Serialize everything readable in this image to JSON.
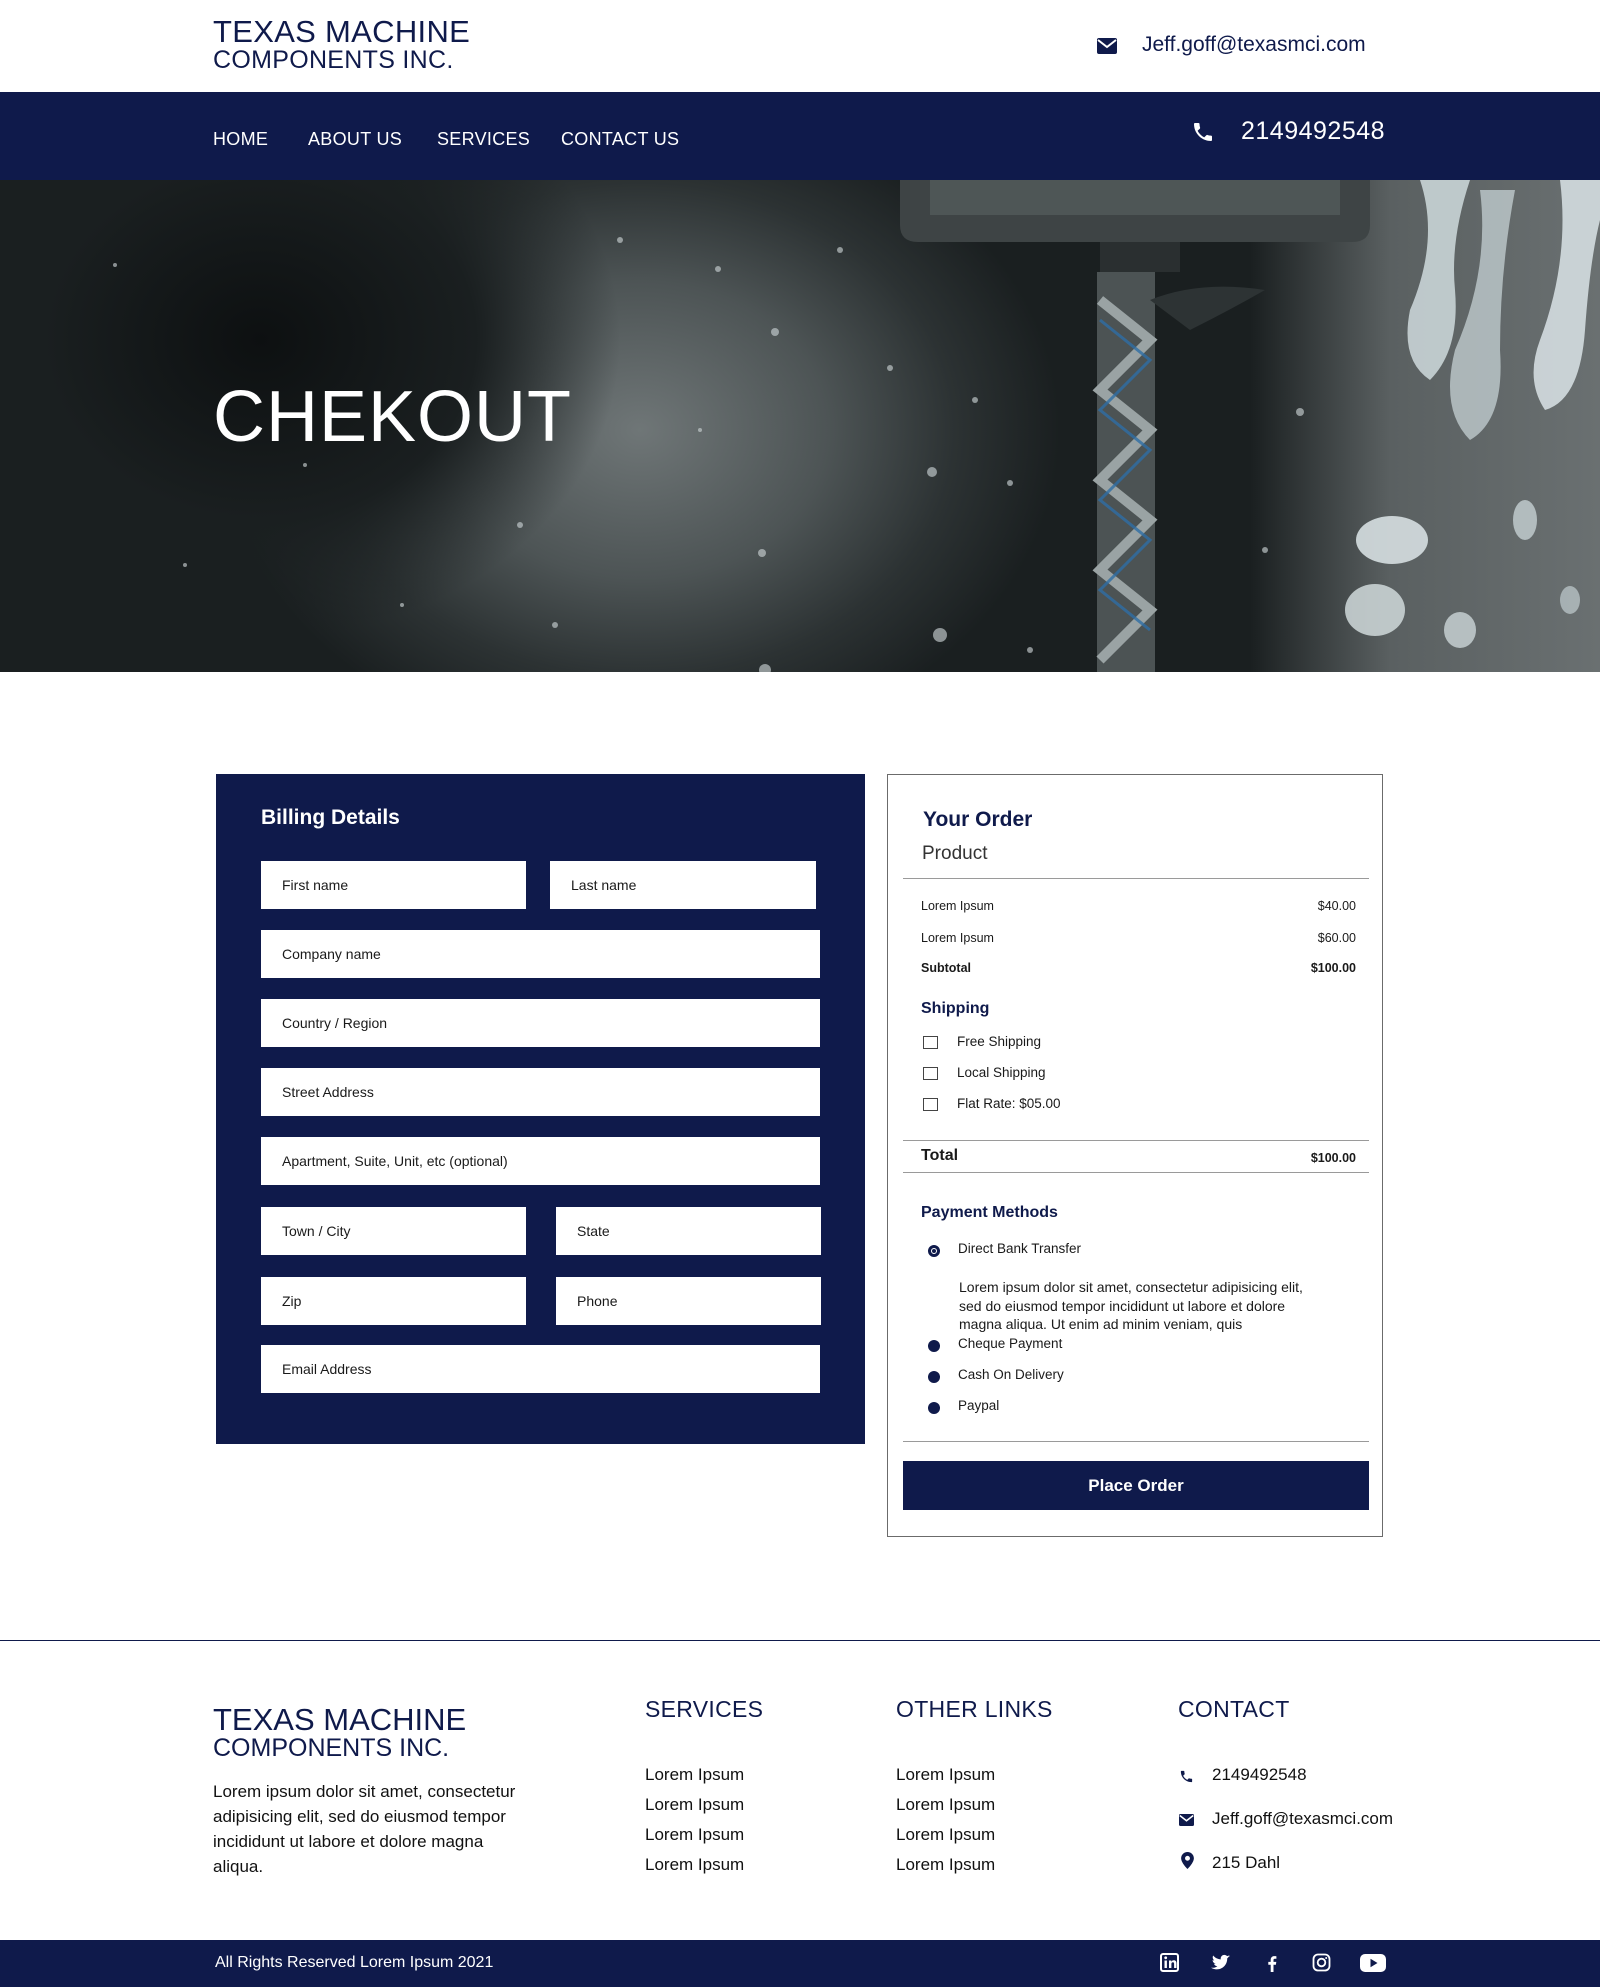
{
  "header": {
    "logo_line1": "TEXAS MACHINE",
    "logo_line2": "COMPONENTS INC.",
    "email": "Jeff.goff@texasmci.com"
  },
  "nav": {
    "items": [
      {
        "label": "HOME"
      },
      {
        "label": "ABOUT US"
      },
      {
        "label": "SERVICES"
      },
      {
        "label": "CONTACT US"
      }
    ],
    "phone": "2149492548"
  },
  "hero": {
    "title": "CHEKOUT"
  },
  "billing": {
    "title": "Billing Details",
    "fields": {
      "first_name": "First name",
      "last_name": "Last name",
      "company": "Company name",
      "country": "Country / Region",
      "street": "Street Address",
      "apartment": "Apartment, Suite, Unit, etc (optional)",
      "town": "Town / City",
      "state": "State",
      "zip": "Zip",
      "phone": "Phone",
      "email": "Email Address"
    }
  },
  "order": {
    "title": "Your Order",
    "product_header": "Product",
    "items": [
      {
        "name": "Lorem Ipsum",
        "price": "$40.00"
      },
      {
        "name": "Lorem Ipsum",
        "price": "$60.00"
      }
    ],
    "subtotal_label": "Subtotal",
    "subtotal_value": "$100.00",
    "shipping_title": "Shipping",
    "shipping_options": [
      {
        "label": "Free Shipping",
        "checked": false
      },
      {
        "label": "Local Shipping",
        "checked": false
      },
      {
        "label": "Flat Rate: $05.00",
        "checked": false
      }
    ],
    "total_label": "Total",
    "total_value": "$100.00",
    "payment_title": "Payment Methods",
    "payment_methods": [
      {
        "label": "Direct Bank Transfer",
        "selected": true
      },
      {
        "label": "Cheque Payment",
        "selected": false
      },
      {
        "label": "Cash On Delivery",
        "selected": false
      },
      {
        "label": "Paypal",
        "selected": false
      }
    ],
    "payment_description": "Lorem ipsum dolor sit amet, consectetur adipisicing elit, sed do eiusmod tempor incididunt ut labore et dolore magna aliqua. Ut enim ad minim veniam, quis",
    "place_order_label": "Place Order"
  },
  "footer": {
    "logo_line1": "TEXAS MACHINE",
    "logo_line2": "COMPONENTS INC.",
    "description": "Lorem ipsum dolor sit amet, consectetur adipisicing elit, sed do eiusmod tempor incididunt ut labore et dolore magna aliqua.",
    "services_title": "SERVICES",
    "services_links": [
      "Lorem Ipsum",
      "Lorem Ipsum",
      "Lorem Ipsum",
      "Lorem Ipsum"
    ],
    "other_title": "OTHER LINKS",
    "other_links": [
      "Lorem Ipsum",
      "Lorem Ipsum",
      "Lorem Ipsum",
      "Lorem Ipsum"
    ],
    "contact_title": "CONTACT",
    "contact_phone": "2149492548",
    "contact_email": "Jeff.goff@texasmci.com",
    "contact_address": "215 Dahl",
    "copyright": "All Rights Reserved Lorem Ipsum 2021",
    "social_icons": [
      "linkedin-icon",
      "twitter-icon",
      "facebook-icon",
      "instagram-icon",
      "youtube-icon"
    ]
  },
  "colors": {
    "brand_navy": "#0f1a4b",
    "white": "#ffffff"
  }
}
